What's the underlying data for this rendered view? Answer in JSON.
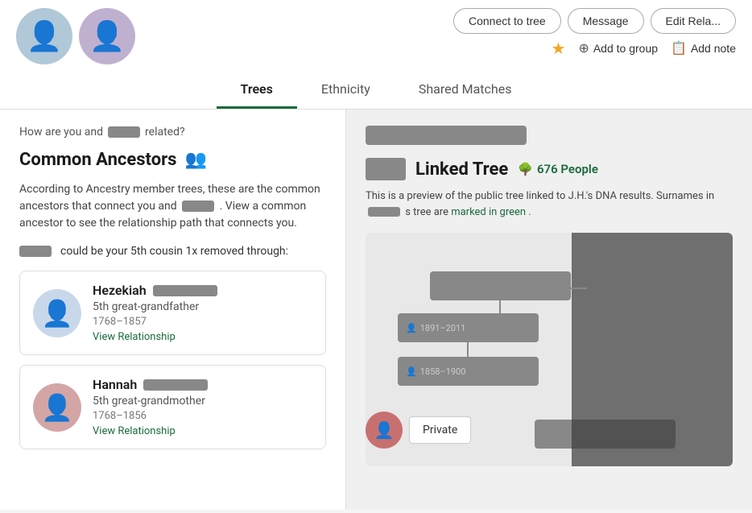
{
  "header": {
    "connect_to_tree": "Connect to tree",
    "message": "Message",
    "edit_relationship": "Edit Rela...",
    "star": "★",
    "add_to_group": "Add to group",
    "add_note": "Add note"
  },
  "tabs": {
    "trees": "Trees",
    "ethnicity": "Ethnicity",
    "shared_matches": "Shared Matches",
    "active": "trees"
  },
  "left_panel": {
    "how_related_prefix": "How are you and",
    "how_related_suffix": "related?",
    "section_title": "Common Ancestors",
    "description": "According to Ancestry member trees, these are the common ancestors that connect you and",
    "description_suffix": ". View a common ancestor to see the relationship path that connects you.",
    "could_be_prefix": "could be your 5th cousin 1x removed through:",
    "ancestors": [
      {
        "name": "Hezekiah",
        "relation": "5th great-grandfather",
        "years": "1768–1857",
        "view_relationship": "View Relationship",
        "gender": "male"
      },
      {
        "name": "Hannah",
        "relation": "5th great-grandmother",
        "years": "1768–1856",
        "view_relationship": "View Relationship",
        "gender": "female"
      }
    ]
  },
  "right_panel": {
    "linked_tree_label": "Linked Tree",
    "people_count": "676 People",
    "description": "This is a preview of the public tree linked to J.H.'s DNA results. Surnames in",
    "description_suffix": "s tree are",
    "marked_green": "marked in green",
    "description_end": ".",
    "private_label": "Private"
  },
  "icons": {
    "ancestors": "👥",
    "tree": "🌳",
    "plus": "⊕",
    "note": "📋",
    "person_male": "👤",
    "person_female": "👤"
  }
}
